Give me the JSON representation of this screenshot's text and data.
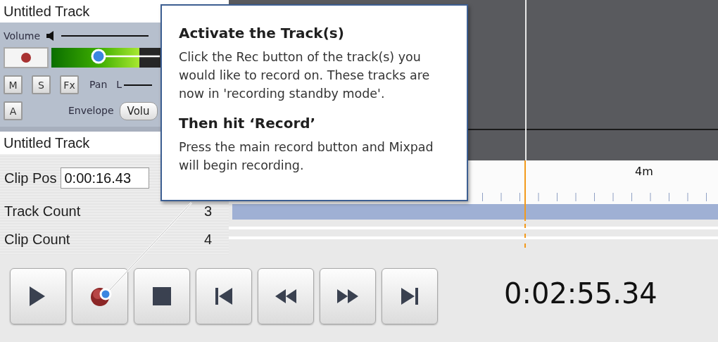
{
  "tracks": [
    {
      "title": "Untitled Track",
      "volume_label": "Volume",
      "meter": {
        "level": 0.8
      },
      "buttons": [
        "M",
        "S",
        "Fx"
      ],
      "pan_label": "Pan",
      "pan_left": "L",
      "auto_button": "A",
      "envelope_label": "Envelope",
      "envelope_value": "Volu"
    },
    {
      "title": "Untitled Track"
    }
  ],
  "info": [
    {
      "label": "Clip Pos",
      "value": "0:00:16.43",
      "kind": "field"
    },
    {
      "label": "Track Count",
      "value": "3",
      "kind": "text"
    },
    {
      "label": "Clip Count",
      "value": "4",
      "kind": "text"
    }
  ],
  "timeline": {
    "ruler_label": "4m"
  },
  "tooltip": {
    "sections": [
      {
        "heading": "Activate the Track(s)",
        "body": "Click the Rec button of the track(s) you would like to record on. These tracks are now in 'recording standby mode'."
      },
      {
        "heading": "Then hit ‘Record’",
        "body": "Press the main record button and Mixpad will begin recording."
      }
    ]
  },
  "transport": {
    "buttons": [
      {
        "kind": "play"
      },
      {
        "kind": "record"
      },
      {
        "kind": "stop"
      },
      {
        "kind": "start"
      },
      {
        "kind": "rewind"
      },
      {
        "kind": "forward"
      },
      {
        "kind": "end"
      }
    ],
    "time": "0:02:55.34"
  }
}
